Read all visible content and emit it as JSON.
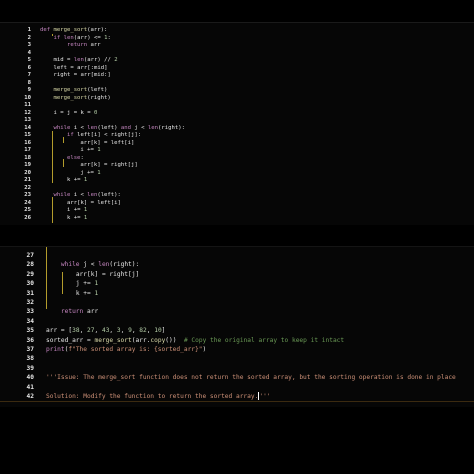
{
  "top_pane": {
    "lines": [
      {
        "num": "1",
        "text": "def merge_sort(arr):"
      },
      {
        "num": "2",
        "text": "    if len(arr) <= 1:"
      },
      {
        "num": "3",
        "text": "        return arr"
      },
      {
        "num": "4",
        "text": ""
      },
      {
        "num": "5",
        "text": "    mid = len(arr) // 2"
      },
      {
        "num": "6",
        "text": "    left = arr[:mid]"
      },
      {
        "num": "7",
        "text": "    right = arr[mid:]"
      },
      {
        "num": "8",
        "text": ""
      },
      {
        "num": "9",
        "text": "    merge_sort(left)"
      },
      {
        "num": "10",
        "text": "    merge_sort(right)"
      },
      {
        "num": "11",
        "text": ""
      },
      {
        "num": "12",
        "text": "    i = j = k = 0"
      },
      {
        "num": "13",
        "text": ""
      },
      {
        "num": "14",
        "text": "    while i < len(left) and j < len(right):"
      },
      {
        "num": "15",
        "text": "        if left[i] < right[j]:"
      },
      {
        "num": "16",
        "text": "            arr[k] = left[i]"
      },
      {
        "num": "17",
        "text": "            i += 1"
      },
      {
        "num": "18",
        "text": "        else:"
      },
      {
        "num": "19",
        "text": "            arr[k] = right[j]"
      },
      {
        "num": "20",
        "text": "            j += 1"
      },
      {
        "num": "21",
        "text": "        k += 1"
      },
      {
        "num": "22",
        "text": ""
      },
      {
        "num": "23",
        "text": "    while i < len(left):"
      },
      {
        "num": "24",
        "text": "        arr[k] = left[i]"
      },
      {
        "num": "25",
        "text": "        i += 1"
      },
      {
        "num": "26",
        "text": "        k += 1"
      }
    ]
  },
  "bottom_pane": {
    "lines": [
      {
        "num": "27",
        "text": ""
      },
      {
        "num": "28",
        "text": "    while j < len(right):"
      },
      {
        "num": "29",
        "text": "        arr[k] = right[j]"
      },
      {
        "num": "30",
        "text": "        j += 1"
      },
      {
        "num": "31",
        "text": "        k += 1"
      },
      {
        "num": "32",
        "text": ""
      },
      {
        "num": "33",
        "text": "    return arr"
      },
      {
        "num": "34",
        "text": ""
      },
      {
        "num": "35",
        "text": "arr = [38, 27, 43, 3, 9, 82, 10]"
      },
      {
        "num": "36",
        "text": "sorted_arr = merge_sort(arr.copy())  # Copy the original array to keep it intact"
      },
      {
        "num": "37",
        "text": "print(f\"The sorted array is: {sorted_arr}\")"
      },
      {
        "num": "38",
        "text": ""
      },
      {
        "num": "39",
        "text": ""
      },
      {
        "num": "40",
        "text": "'''Issue: The merge_sort function does not return the sorted array, but the sorting operation is done in place"
      },
      {
        "num": "41",
        "text": ""
      },
      {
        "num": "42",
        "text": "Solution: Modify the function to return the sorted array.'''"
      }
    ]
  },
  "colors": {
    "keyword": "#c586c0",
    "number": "#b5cea8",
    "string": "#ce9178",
    "comment": "#6a9955",
    "indent_guide": "#b39c2c"
  }
}
